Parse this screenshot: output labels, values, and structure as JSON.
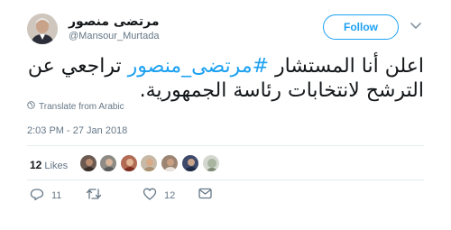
{
  "author": {
    "name": "مرتضى منصور",
    "handle": "@Mansour_Murtada"
  },
  "follow_button": {
    "label": "Follow"
  },
  "tweet": {
    "text_before": "اعلن أنا المستشار ",
    "hashtag": "#مرتضى_منصور",
    "text_after": " تراجعي عن الترشح لانتخابات رئاسة الجمهورية."
  },
  "translate": {
    "label": "Translate from Arabic"
  },
  "timestamp": "2:03 PM - 27 Jan 2018",
  "likes": {
    "count": "12",
    "label": "Likes"
  },
  "actions": {
    "reply_count": "11",
    "retweet_count": "",
    "like_count": "12"
  },
  "colors": {
    "accent": "#1da1f2",
    "secondary_text": "#657786",
    "divider": "#e6ecf0"
  },
  "icons": [
    "caret-down-icon",
    "globe-icon",
    "reply-icon",
    "retweet-icon",
    "heart-icon",
    "direct-message-icon"
  ]
}
